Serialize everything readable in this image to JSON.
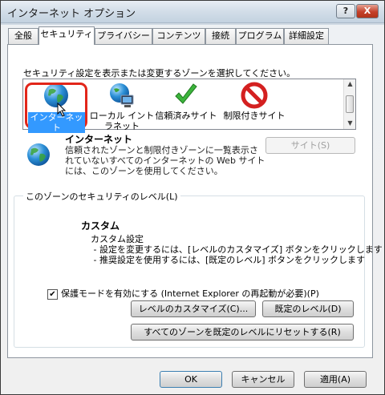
{
  "window": {
    "title": "インターネット オプション",
    "help": "?",
    "close": "X"
  },
  "tabs": [
    {
      "label": "全般"
    },
    {
      "label": "セキュリティ"
    },
    {
      "label": "プライバシー"
    },
    {
      "label": "コンテンツ"
    },
    {
      "label": "接続"
    },
    {
      "label": "プログラム"
    },
    {
      "label": "詳細設定"
    }
  ],
  "security": {
    "instruction": "セキュリティ設定を表示または変更するゾーンを選択してください。",
    "zones": [
      {
        "label": "インターネット",
        "icon": "globe-icon"
      },
      {
        "label": "ローカル イントラネット",
        "icon": "intranet-icon"
      },
      {
        "label": "信頼済みサイト",
        "icon": "checkmark-icon"
      },
      {
        "label": "制限付きサイト",
        "icon": "prohibited-icon"
      }
    ],
    "selected_zone": {
      "title": "インターネット",
      "description": "信頼されたゾーンと制限付きゾーンに一覧表示されていないすべてのインターネットの Web サイトには、このゾーンを使用してください。"
    },
    "sites_button": "サイト(S)",
    "level_group": {
      "legend": "このゾーンのセキュリティのレベル(L)",
      "title": "カスタム",
      "body": "カスタム設定\n - 設定を変更するには、[レベルのカスタマイズ] ボタンをクリックします\n - 推奨設定を使用するには、[既定のレベル] ボタンをクリックします",
      "protected_mode": "保護モードを有効にする (Internet Explorer の再起動が必要)(P)",
      "protected_mode_checked": true,
      "customize_button": "レベルのカスタマイズ(C)...",
      "default_button": "既定のレベル(D)"
    },
    "reset_all_button": "すべてのゾーンを既定のレベルにリセットする(R)"
  },
  "footer": {
    "ok": "OK",
    "cancel": "キャンセル",
    "apply": "適用(A)"
  },
  "colors": {
    "selection_ring": "#e2261a",
    "selection_fill": "#3399ff",
    "check_green": "#3cb43c",
    "prohibit_red": "#d42020"
  }
}
